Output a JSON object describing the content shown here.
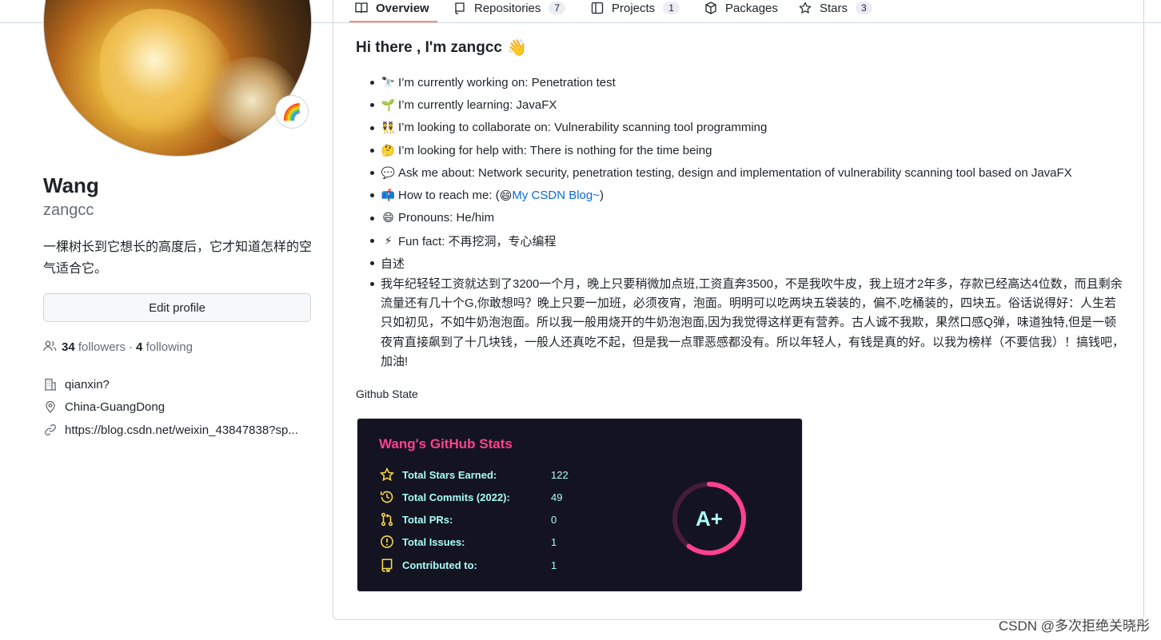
{
  "nav": {
    "tabs": [
      {
        "label": "Overview",
        "count": ""
      },
      {
        "label": "Repositories",
        "count": "7"
      },
      {
        "label": "Projects",
        "count": "1"
      },
      {
        "label": "Packages",
        "count": ""
      },
      {
        "label": "Stars",
        "count": "3"
      }
    ]
  },
  "profile": {
    "status_emoji": "🌈",
    "name": "Wang",
    "login": "zangcc",
    "bio": "一棵树长到它想长的高度后，它才知道怎样的空气适合它。",
    "edit_label": "Edit profile",
    "followers_count": "34",
    "followers_label": "followers",
    "separator": "·",
    "following_count": "4",
    "following_label": "following",
    "company": "qianxin?",
    "location": "China-GuangDong",
    "website": "https://blog.csdn.net/weixin_43847838?sp..."
  },
  "readme": {
    "title": "Hi there , I'm zangcc",
    "title_emoji": "👋",
    "items": [
      {
        "emoji": "🔭",
        "text": "I’m currently working on: Penetration test"
      },
      {
        "emoji": "🌱",
        "text": "I’m currently learning: JavaFX"
      },
      {
        "emoji": "👯",
        "text": "I’m looking to collaborate on: Vulnerability scanning tool programming"
      },
      {
        "emoji": "🤔",
        "text": "I’m looking for help with: There is nothing for the time being"
      },
      {
        "emoji": "💬",
        "text": "Ask me about: Network security, penetration testing, design and implementation of vulnerability scanning tool based on JavaFX"
      },
      {
        "emoji": "📫",
        "text": "How to reach me: (",
        "link_emoji": "😄",
        "link": "My CSDN Blog~",
        "after": ")"
      },
      {
        "emoji": "😄",
        "text": "Pronouns: He/him"
      },
      {
        "emoji": "⚡",
        "text": "Fun fact: 不再挖洞，专心编程"
      },
      {
        "emoji": "",
        "text": "自述"
      }
    ],
    "long_text": "我年纪轻轻工资就达到了3200一个月，晚上只要稍微加点班,工资直奔3500，不是我吹牛皮，我上班才2年多，存款已经高达4位数，而且剩余流量还有几十个G,你敢想吗？晚上只要一加班，必须夜宵，泡面。明明可以吃两块五袋装的，偏不,吃桶装的，四块五。俗话说得好：人生若只如初见，不如牛奶泡泡面。所以我一般用烧开的牛奶泡泡面,因为我觉得这样更有营养。古人诚不我欺，果然口感Q弹，味道独特,但是一顿夜宵直接飙到了十几块钱，一般人还真吃不起，但是我一点罪恶感都没有。所以年轻人，有钱是真的好。以我为榜样（不要信我）！搞钱吧，加油!",
    "section_label": "Github State"
  },
  "stats_card": {
    "title": "Wang's GitHub Stats",
    "rows": [
      {
        "icon": "star-icon",
        "label": "Total Stars Earned:",
        "value": "122"
      },
      {
        "icon": "history-icon",
        "label": "Total Commits (2022):",
        "value": "49"
      },
      {
        "icon": "pull-request-icon",
        "label": "Total PRs:",
        "value": "0"
      },
      {
        "icon": "issue-icon",
        "label": "Total Issues:",
        "value": "1"
      },
      {
        "icon": "repo-icon",
        "label": "Contributed to:",
        "value": "1"
      }
    ],
    "grade": "A+",
    "ring_fill": 0.6,
    "colors": {
      "bg": "#141321",
      "title": "#fe428e",
      "text": "#a9fef7",
      "icon": "#f8d847"
    }
  },
  "watermark": "CSDN @多次拒绝关晓彤"
}
